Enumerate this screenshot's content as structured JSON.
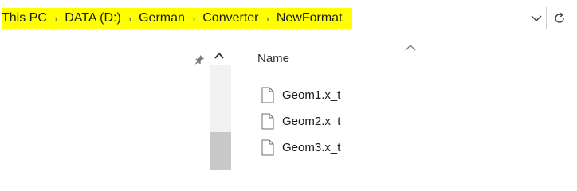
{
  "address_bar": {
    "breadcrumbs": [
      "This PC",
      "DATA (D:)",
      "German",
      "Converter",
      "NewFormat"
    ],
    "separator": "›",
    "highlight_color": "#ffff00"
  },
  "icons": {
    "dropdown": "chevron-down-icon",
    "refresh": "refresh-icon",
    "pin": "pin-icon",
    "scroll_up": "chevron-up-icon",
    "sort": "sort-ascending-icon",
    "file": "document-icon"
  },
  "file_list": {
    "column_header": "Name",
    "files": [
      "Geom1.x_t",
      "Geom2.x_t",
      "Geom3.x_t"
    ]
  }
}
